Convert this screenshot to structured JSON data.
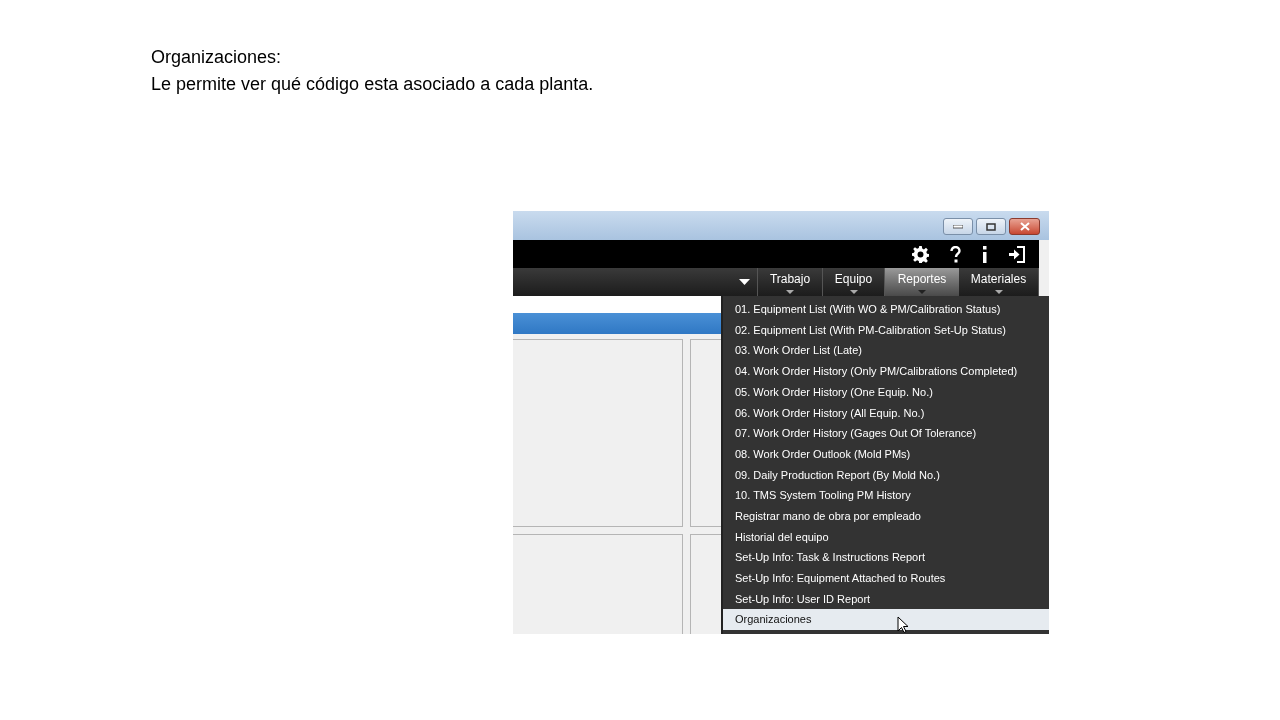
{
  "slide": {
    "title": "Organizaciones:",
    "body": "Le permite ver qué código esta asociado a cada planta."
  },
  "app": {
    "nav_tabs": [
      {
        "label": "Trabajo",
        "selected": false
      },
      {
        "label": "Equipo",
        "selected": false
      },
      {
        "label": "Reportes",
        "selected": true
      },
      {
        "label": "Materiales",
        "selected": false
      }
    ],
    "report_menu": [
      {
        "label": "01. Equipment List (With WO & PM/Calibration Status)",
        "selected": false
      },
      {
        "label": "02. Equipment List (With PM-Calibration Set-Up Status)",
        "selected": false
      },
      {
        "label": "03. Work Order List (Late)",
        "selected": false
      },
      {
        "label": "04. Work Order History (Only PM/Calibrations Completed)",
        "selected": false
      },
      {
        "label": "05. Work Order History (One Equip. No.)",
        "selected": false
      },
      {
        "label": "06. Work Order History (All Equip. No.)",
        "selected": false
      },
      {
        "label": "07. Work Order History (Gages Out Of Tolerance)",
        "selected": false
      },
      {
        "label": "08. Work Order Outlook (Mold PMs)",
        "selected": false
      },
      {
        "label": "09. Daily Production Report (By Mold No.)",
        "selected": false
      },
      {
        "label": "10. TMS System Tooling PM History",
        "selected": false
      },
      {
        "label": "Registrar mano de obra por empleado",
        "selected": false
      },
      {
        "label": "Historial del equipo",
        "selected": false
      },
      {
        "label": "Set-Up Info: Task & Instructions Report",
        "selected": false
      },
      {
        "label": "Set-Up Info: Equipment Attached to Routes",
        "selected": false
      },
      {
        "label": "Set-Up Info: User ID Report",
        "selected": false
      },
      {
        "label": "Organizaciones",
        "selected": true
      }
    ]
  }
}
